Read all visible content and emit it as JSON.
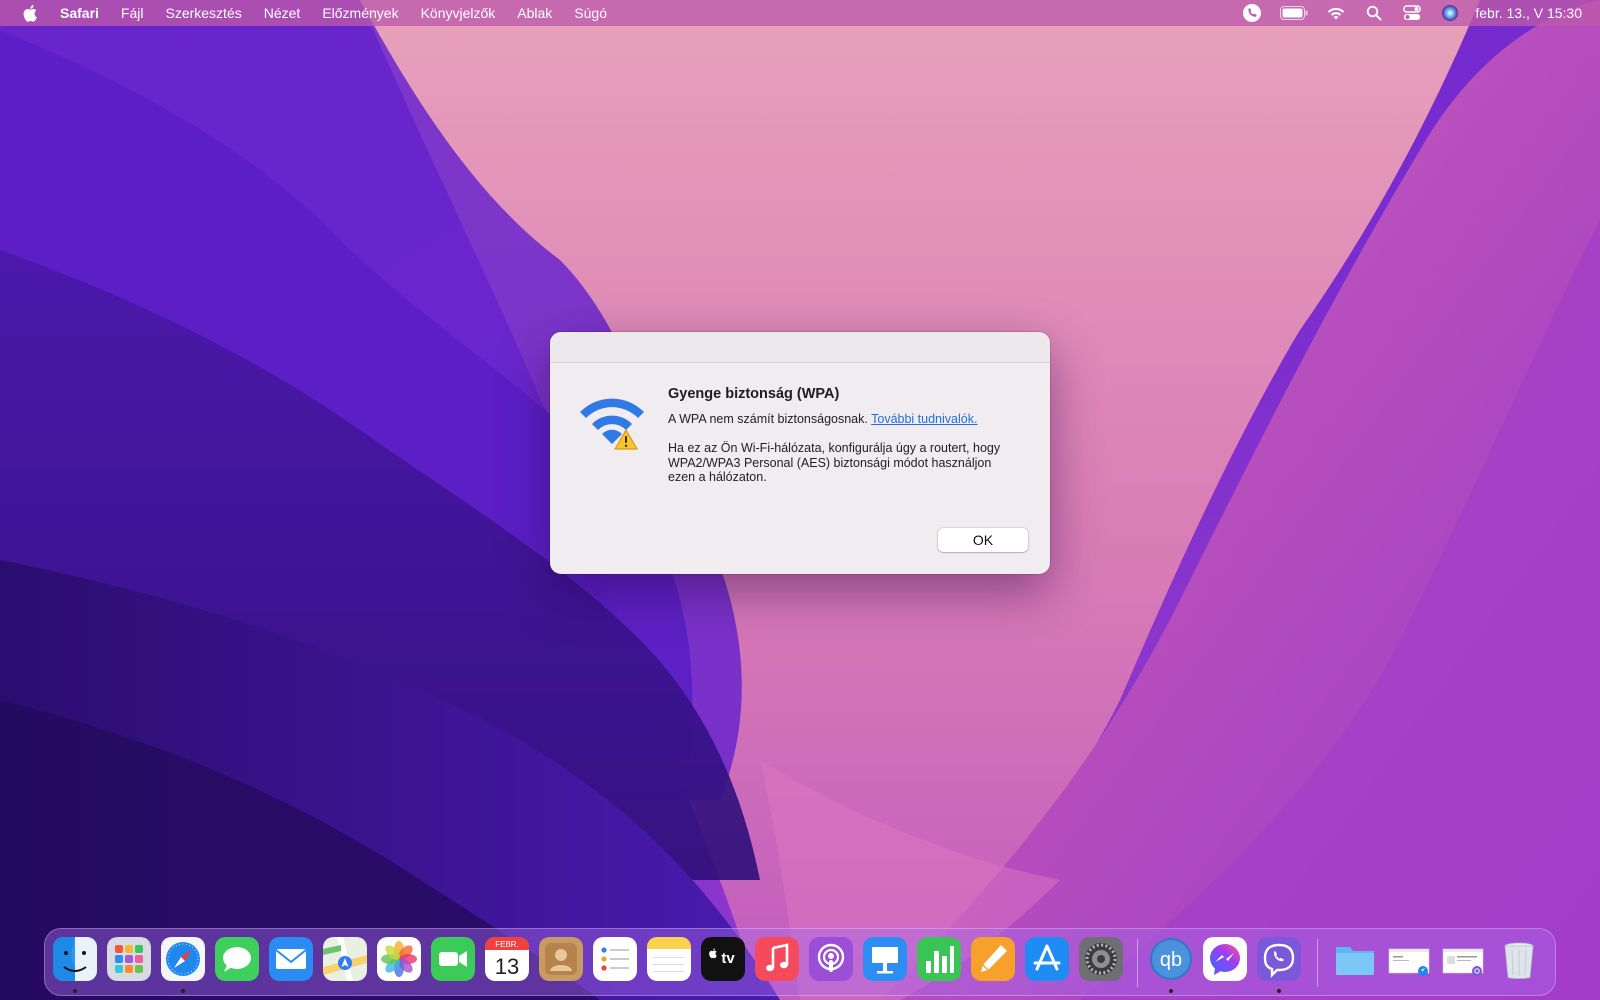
{
  "menubar": {
    "apple_icon": "apple-icon",
    "app_name": "Safari",
    "items": [
      "Fájl",
      "Szerkesztés",
      "Nézet",
      "Előzmények",
      "Könyvjelzők",
      "Ablak",
      "Súgó"
    ],
    "status_icons": [
      "viber-icon",
      "battery-icon",
      "wifi-icon",
      "search-icon",
      "control-center-icon",
      "siri-icon"
    ],
    "clock": "febr. 13., V  15:30"
  },
  "dialog": {
    "icon": "wifi-warning-icon",
    "title": "Gyenge biztonság (WPA)",
    "message": "A WPA nem számít biztonságosnak.",
    "link": "További tudnivalók.",
    "detail_lines": [
      "Ha ez az Ön Wi-Fi-hálózata, konfigurálja úgy a routert, hogy",
      "WPA2/WPA3 Personal (AES) biztonsági módot használjon",
      "ezen a hálózaton."
    ],
    "ok_button": "OK"
  },
  "dock": {
    "apps": [
      {
        "icon": "finder-icon",
        "running": true
      },
      {
        "icon": "launchpad-icon",
        "running": false
      },
      {
        "icon": "safari-icon",
        "running": true
      },
      {
        "icon": "messages-icon",
        "running": false
      },
      {
        "icon": "mail-icon",
        "running": false
      },
      {
        "icon": "maps-icon",
        "running": false
      },
      {
        "icon": "photos-icon",
        "running": false
      },
      {
        "icon": "facetime-icon",
        "running": false
      },
      {
        "icon": "calendar-icon",
        "running": false,
        "month": "FEBR.",
        "day": "13"
      },
      {
        "icon": "contacts-icon",
        "running": false
      },
      {
        "icon": "reminders-icon",
        "running": false
      },
      {
        "icon": "notes-icon",
        "running": false
      },
      {
        "icon": "apple-tv-icon",
        "running": false,
        "label": "tv"
      },
      {
        "icon": "music-icon",
        "running": false
      },
      {
        "icon": "podcasts-icon",
        "running": false
      },
      {
        "icon": "keynote-icon",
        "running": false
      },
      {
        "icon": "numbers-icon",
        "running": false
      },
      {
        "icon": "pages-icon",
        "running": false
      },
      {
        "icon": "app-store-icon",
        "running": false
      },
      {
        "icon": "system-preferences-icon",
        "running": false
      },
      {
        "icon": "qbittorrent-icon",
        "running": true,
        "label": "qb"
      },
      {
        "icon": "messenger-icon",
        "running": false
      },
      {
        "icon": "viber-icon",
        "running": true
      },
      {
        "icon": "downloads-folder-icon",
        "running": false
      },
      {
        "icon": "minimized-window-icon",
        "running": false
      },
      {
        "icon": "minimized-window-icon",
        "running": false
      },
      {
        "icon": "trash-icon",
        "running": false
      }
    ]
  }
}
